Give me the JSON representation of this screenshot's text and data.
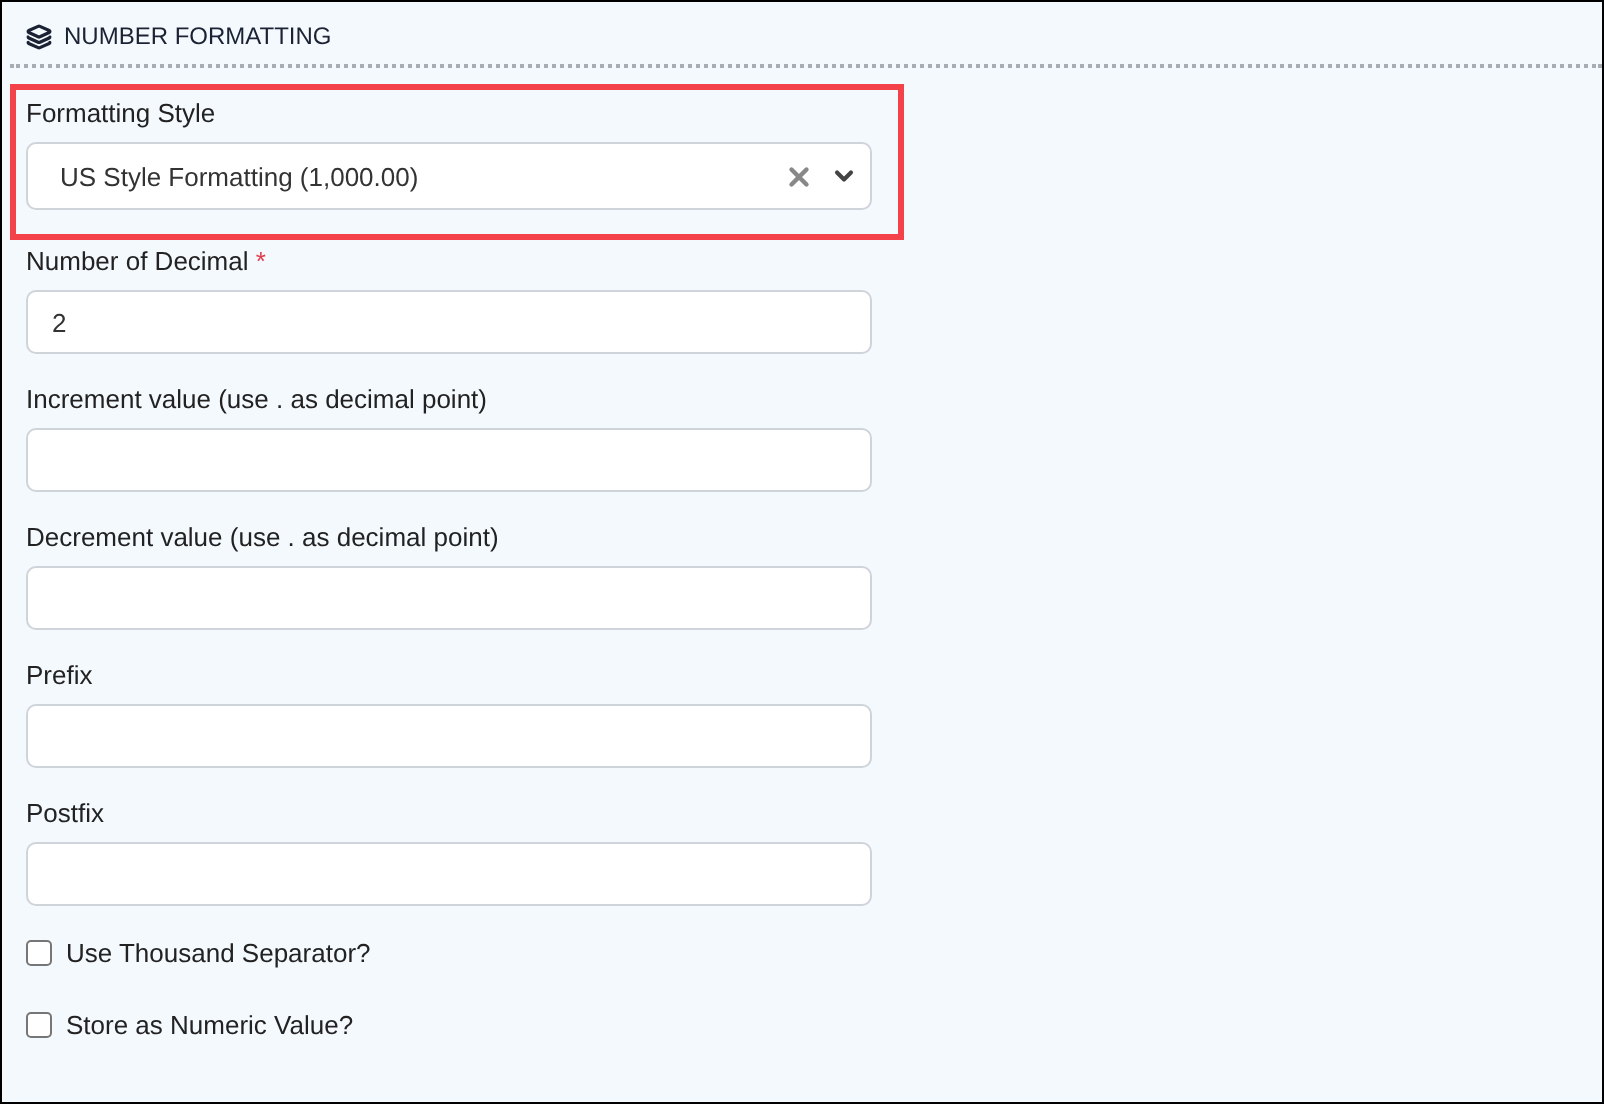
{
  "section": {
    "title": "NUMBER FORMATTING"
  },
  "fields": [
    {
      "kind": "select",
      "label": "Formatting Style",
      "highlighted": true,
      "value": "US Style Formatting (1,000.00)"
    },
    {
      "kind": "text",
      "label": "Number of Decimal",
      "required_mark": "*",
      "value": "2"
    },
    {
      "kind": "text",
      "label": "Increment value (use . as decimal point)"
    },
    {
      "kind": "text",
      "label": "Decrement value (use . as decimal point)"
    },
    {
      "kind": "text",
      "label": "Prefix"
    },
    {
      "kind": "text",
      "label": "Postfix"
    }
  ],
  "checkboxes": [
    {
      "label": "Use Thousand Separator?",
      "checked": false
    },
    {
      "label": "Store as Numeric Value?",
      "checked": false
    }
  ]
}
